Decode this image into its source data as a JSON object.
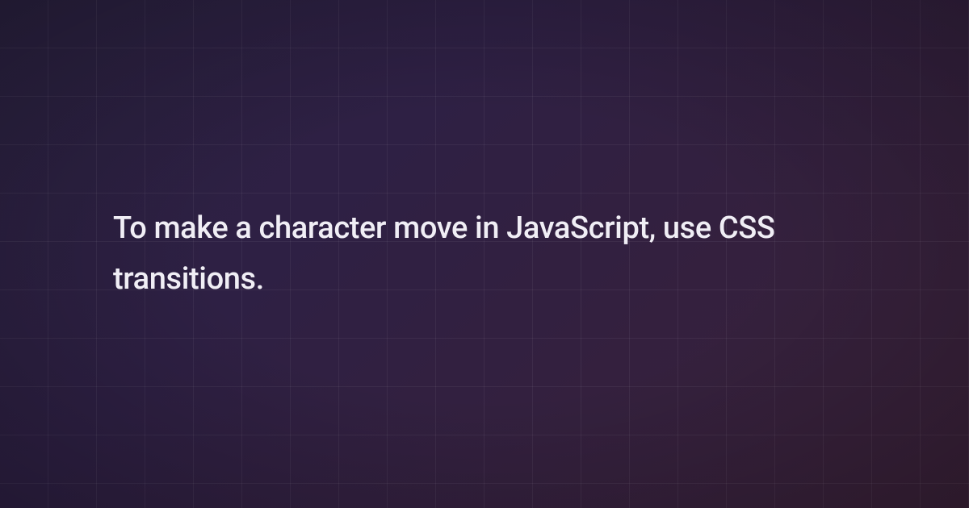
{
  "headline": "To make a character move in JavaScript, use CSS transitions."
}
